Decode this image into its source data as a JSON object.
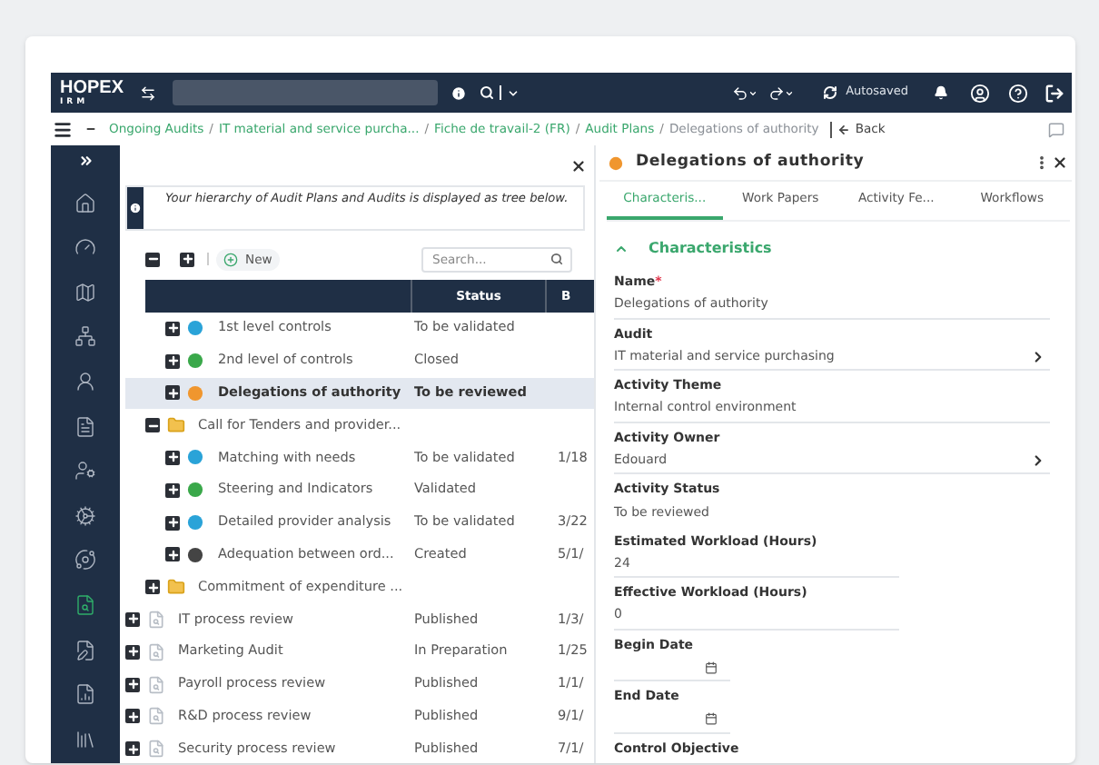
{
  "header": {
    "logo": "HOPEX",
    "logo_sub": "IRM",
    "status": "Autosaved"
  },
  "breadcrumb": {
    "separator": "/",
    "items": [
      {
        "label": "Ongoing Audits",
        "link": true
      },
      {
        "label": "IT material and service purcha...",
        "link": true
      },
      {
        "label": "Fiche de travail-2 (FR)",
        "link": true
      },
      {
        "label": "Audit Plans",
        "link": true
      },
      {
        "label": "Delegations of authority",
        "link": false
      }
    ],
    "back": "Back"
  },
  "sidebar": {
    "items": [
      {
        "kind": "home",
        "selected": false
      },
      {
        "kind": "gauge",
        "selected": false
      },
      {
        "kind": "map",
        "selected": false
      },
      {
        "kind": "org",
        "selected": false
      },
      {
        "kind": "user",
        "selected": false
      },
      {
        "kind": "doc",
        "selected": false
      },
      {
        "kind": "person",
        "selected": false
      },
      {
        "kind": "gears",
        "selected": false
      },
      {
        "kind": "cycle",
        "selected": false
      },
      {
        "kind": "audit",
        "selected": true
      },
      {
        "kind": "edit",
        "selected": false
      },
      {
        "kind": "report",
        "selected": false
      },
      {
        "kind": "library",
        "selected": false
      }
    ]
  },
  "left_panel": {
    "info": "Your hierarchy of Audit Plans and Audits is displayed as tree below.",
    "new_button": "New",
    "search": {
      "placeholder": "Search..."
    },
    "columns": [
      "Status",
      "B"
    ],
    "tree": [
      {
        "children": [
          {
            "children": [
              {
                "kind": "activity",
                "color": "#2aa3d8",
                "label": "1st level controls",
                "status": "To be validated",
                "selected": false,
                "expanded": false
              },
              {
                "kind": "activity",
                "color": "#3aa84a",
                "label": "2nd level of controls",
                "status": "Closed",
                "selected": false,
                "expanded": false
              },
              {
                "kind": "activity",
                "color": "#f0962e",
                "label": "Delegations of authority",
                "status": "To be reviewed",
                "selected": true,
                "expanded": false
              }
            ]
          },
          {
            "kind": "folder",
            "label": "Call for Tenders and provider...",
            "selected": false,
            "expanded": true,
            "children": [
              {
                "kind": "activity",
                "color": "#2aa3d8",
                "label": "Matching with needs",
                "status": "To be validated",
                "column_3": "1/18",
                "selected": false,
                "expanded": false
              },
              {
                "kind": "activity",
                "color": "#3aa84a",
                "label": "Steering and Indicators",
                "status": "Validated",
                "selected": false,
                "expanded": false
              },
              {
                "kind": "activity",
                "color": "#2aa3d8",
                "label": "Detailed provider analysis",
                "status": "To be validated",
                "column_3": "3/22",
                "selected": false,
                "expanded": false
              },
              {
                "kind": "activity",
                "color": "#444444",
                "label": "Adequation between ord...",
                "status": "Created",
                "column_3": "5/1/",
                "selected": false,
                "expanded": false
              }
            ]
          },
          {
            "kind": "folder",
            "label": "Commitment of expenditure ...",
            "selected": false,
            "expanded": false
          }
        ]
      },
      {
        "kind": "audit",
        "label": "IT process review",
        "status": "Published",
        "column_3": "1/3/",
        "selected": false,
        "expanded": false
      },
      {
        "kind": "audit",
        "label": "Marketing Audit",
        "status": "In Preparation",
        "column_3": "1/25",
        "selected": false,
        "expanded": false
      },
      {
        "kind": "audit",
        "label": "Payroll process review",
        "status": "Published",
        "column_3": "1/1/",
        "selected": false,
        "expanded": false
      },
      {
        "kind": "audit",
        "label": "R&D process review",
        "status": "Published",
        "column_3": "9/1/",
        "selected": false,
        "expanded": false
      },
      {
        "kind": "audit",
        "label": "Security process review",
        "status": "Published",
        "column_3": "7/1/",
        "selected": false,
        "expanded": false
      }
    ]
  },
  "right_panel": {
    "title": "Delegations of authority",
    "tabs": [
      {
        "label": "Characteris...",
        "selected": true
      },
      {
        "label": "Work Papers",
        "selected": false
      },
      {
        "label": "Activity Fe...",
        "selected": false
      },
      {
        "label": "Workflows",
        "selected": false
      }
    ],
    "section": {
      "title": "Characteristics",
      "expanded": true
    },
    "required_mark": "*",
    "fields": [
      {
        "kind": "text",
        "label": "Name",
        "required": true,
        "value": "Delegations of authority"
      },
      {
        "kind": "link",
        "label": "Audit",
        "required": false,
        "value": "IT material and service purchasing"
      },
      {
        "kind": "text",
        "label": "Activity Theme",
        "required": false,
        "value": "Internal control environment"
      },
      {
        "kind": "link",
        "label": "Activity Owner",
        "required": false,
        "value": "Edouard"
      },
      {
        "kind": "plain",
        "label": "Activity Status",
        "required": false,
        "value": "To be reviewed"
      },
      {
        "kind": "short",
        "label": "Estimated Workload (Hours)",
        "required": false,
        "value": "24"
      },
      {
        "kind": "short",
        "label": "Effective Workload (Hours)",
        "required": false,
        "value": "0"
      },
      {
        "kind": "date",
        "label": "Begin Date",
        "required": false
      },
      {
        "kind": "date",
        "label": "End Date",
        "required": false
      },
      {
        "kind": "area",
        "label": "Control Objective",
        "required": false
      }
    ]
  }
}
